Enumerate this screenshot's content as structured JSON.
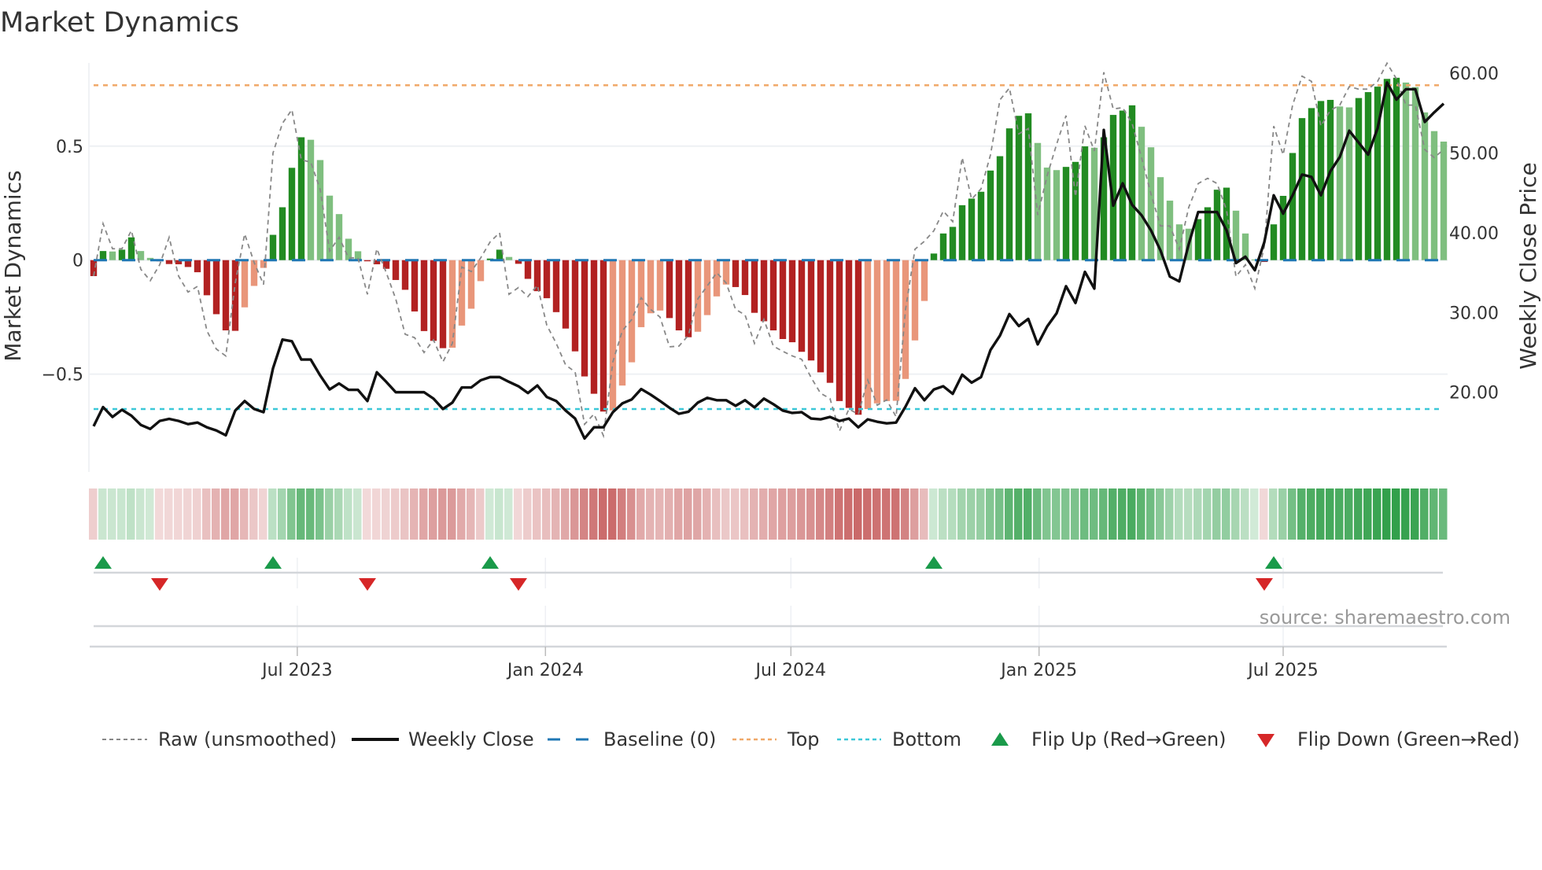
{
  "chart_data": {
    "type": "bar",
    "title": "Market Dynamics",
    "ylabel": "Market Dynamics",
    "ylabel_right": "Weekly Close Price",
    "start_date": "2023-01-31",
    "frequency": "weekly",
    "ylim": [
      -0.929,
      0.865
    ],
    "ylim_right": [
      10,
      61.3
    ],
    "yticks": [
      {
        "value": 0.5,
        "label": "0.5"
      },
      {
        "value": 0,
        "label": "0"
      },
      {
        "value": -0.5,
        "label": "−0.5"
      }
    ],
    "yticks_right": [
      {
        "value": 60,
        "label": "60.00"
      },
      {
        "value": 50,
        "label": "50.00"
      },
      {
        "value": 40,
        "label": "40.00"
      },
      {
        "value": 30,
        "label": "30.00"
      },
      {
        "value": 20,
        "label": "20.00"
      }
    ],
    "xticks": [
      {
        "date": "2023-07-01",
        "label": "Jul 2023"
      },
      {
        "date": "2024-01-01",
        "label": "Jan 2024"
      },
      {
        "date": "2024-07-01",
        "label": "Jul 2024"
      },
      {
        "date": "2025-01-01",
        "label": "Jan 2025"
      },
      {
        "date": "2025-07-01",
        "label": "Jul 2025"
      }
    ],
    "grid": true,
    "baseline": 0,
    "top_level": 0.767,
    "bottom_level": -0.653,
    "momentum": [
      -0.07,
      0.04,
      0.038,
      0.046,
      0.1,
      0.04,
      0.01,
      -0.005,
      -0.017,
      -0.018,
      -0.03,
      -0.053,
      -0.154,
      -0.237,
      -0.308,
      -0.31,
      -0.207,
      -0.113,
      -0.034,
      0.111,
      0.232,
      0.405,
      0.539,
      0.528,
      0.439,
      0.283,
      0.202,
      0.094,
      0.039,
      -0.005,
      -0.018,
      -0.038,
      -0.087,
      -0.13,
      -0.225,
      -0.311,
      -0.354,
      -0.386,
      -0.384,
      -0.287,
      -0.213,
      -0.092,
      0.007,
      0.046,
      0.014,
      -0.016,
      -0.082,
      -0.136,
      -0.167,
      -0.228,
      -0.3,
      -0.4,
      -0.51,
      -0.586,
      -0.664,
      -0.659,
      -0.55,
      -0.448,
      -0.294,
      -0.233,
      -0.221,
      -0.254,
      -0.308,
      -0.338,
      -0.314,
      -0.241,
      -0.159,
      -0.107,
      -0.118,
      -0.153,
      -0.231,
      -0.268,
      -0.308,
      -0.346,
      -0.36,
      -0.402,
      -0.44,
      -0.492,
      -0.538,
      -0.618,
      -0.648,
      -0.678,
      -0.653,
      -0.628,
      -0.618,
      -0.617,
      -0.521,
      -0.352,
      -0.179,
      0.029,
      0.117,
      0.146,
      0.241,
      0.27,
      0.3,
      0.393,
      0.456,
      0.578,
      0.633,
      0.644,
      0.514,
      0.406,
      0.395,
      0.409,
      0.431,
      0.499,
      0.493,
      0.539,
      0.637,
      0.656,
      0.679,
      0.585,
      0.495,
      0.364,
      0.261,
      0.157,
      0.138,
      0.18,
      0.232,
      0.309,
      0.318,
      0.217,
      0.117,
      0.003,
      -0.008,
      0.157,
      0.282,
      0.47,
      0.623,
      0.667,
      0.698,
      0.703,
      0.674,
      0.67,
      0.711,
      0.737,
      0.761,
      0.795,
      0.8,
      0.779,
      0.759,
      0.648,
      0.566,
      0.52
    ],
    "raw": [
      -0.07,
      0.16,
      0.05,
      0.05,
      0.13,
      -0.04,
      -0.09,
      -0.02,
      0.1,
      -0.07,
      -0.14,
      -0.115,
      -0.31,
      -0.39,
      -0.42,
      -0.1,
      0.115,
      -0.01,
      -0.107,
      0.47,
      0.6,
      0.66,
      0.44,
      0.43,
      0.31,
      0.04,
      0.1,
      0.01,
      0.01,
      -0.15,
      0.05,
      -0.055,
      -0.17,
      -0.325,
      -0.34,
      -0.405,
      -0.35,
      -0.446,
      -0.365,
      -0.03,
      -0.05,
      0.01,
      0.08,
      0.12,
      -0.15,
      -0.12,
      -0.16,
      -0.11,
      -0.285,
      -0.365,
      -0.46,
      -0.49,
      -0.72,
      -0.675,
      -0.77,
      -0.446,
      -0.31,
      -0.26,
      -0.165,
      -0.216,
      -0.25,
      -0.38,
      -0.377,
      -0.33,
      -0.17,
      -0.113,
      -0.055,
      -0.1,
      -0.216,
      -0.24,
      -0.365,
      -0.26,
      -0.377,
      -0.4,
      -0.42,
      -0.435,
      -0.515,
      -0.584,
      -0.607,
      -0.75,
      -0.653,
      -0.676,
      -0.526,
      -0.636,
      -0.613,
      -0.687,
      -0.216,
      0.048,
      0.083,
      0.129,
      0.215,
      0.169,
      0.45,
      0.267,
      0.313,
      0.462,
      0.703,
      0.755,
      0.554,
      0.577,
      0.198,
      0.37,
      0.508,
      0.634,
      0.278,
      0.589,
      0.479,
      0.824,
      0.663,
      0.669,
      0.6,
      0.45,
      0.29,
      0.15,
      0.15,
      0.048,
      0.232,
      0.336,
      0.359,
      0.336,
      0.22,
      -0.072,
      -0.02,
      -0.124,
      0.06,
      0.588,
      0.462,
      0.68,
      0.807,
      0.784,
      0.588,
      0.657,
      0.68,
      0.761,
      0.75,
      0.75,
      0.784,
      0.864,
      0.795,
      0.68,
      0.68,
      0.485,
      0.45,
      0.485
    ],
    "close": [
      15.74,
      18.14,
      16.9,
      17.8,
      17.06,
      15.9,
      15.4,
      16.4,
      16.66,
      16.4,
      16.0,
      16.2,
      15.6,
      15.2,
      14.6,
      17.7,
      18.9,
      17.9,
      17.5,
      23.0,
      26.6,
      26.4,
      24.1,
      24.1,
      22.1,
      20.35,
      21.1,
      20.3,
      20.3,
      18.9,
      22.5,
      21.3,
      20.0,
      20.0,
      20.0,
      20.0,
      19.2,
      17.9,
      18.7,
      20.6,
      20.6,
      21.5,
      21.9,
      21.9,
      21.3,
      20.75,
      19.9,
      20.85,
      19.4,
      18.9,
      17.7,
      16.7,
      14.2,
      15.6,
      15.6,
      17.5,
      18.6,
      19.1,
      20.4,
      19.7,
      18.9,
      18.05,
      17.3,
      17.55,
      18.7,
      19.3,
      19.0,
      19.0,
      18.3,
      19.0,
      18.1,
      19.2,
      18.5,
      17.7,
      17.4,
      17.5,
      16.7,
      16.6,
      16.9,
      16.4,
      16.7,
      15.6,
      16.6,
      16.3,
      16.1,
      16.2,
      18.2,
      20.5,
      19.0,
      20.35,
      20.75,
      19.8,
      22.2,
      21.2,
      21.9,
      25.3,
      27.1,
      29.8,
      28.3,
      29.2,
      26.0,
      28.25,
      29.9,
      33.3,
      31.2,
      35.1,
      33.0,
      52.9,
      43.4,
      46.2,
      43.5,
      42.2,
      40.3,
      37.8,
      34.5,
      33.9,
      38.6,
      42.6,
      42.6,
      42.6,
      40.3,
      36.2,
      37.0,
      35.3,
      38.8,
      44.7,
      42.4,
      44.7,
      47.3,
      47.0,
      44.7,
      47.7,
      49.5,
      52.8,
      51.3,
      49.8,
      53.1,
      58.85,
      56.7,
      58.0,
      58.0,
      53.9,
      55.1,
      56.2
    ],
    "flip_up_weeks": [
      1,
      19,
      42,
      89,
      125
    ],
    "flip_down_weeks": [
      7,
      29,
      45,
      124
    ],
    "legend": {
      "placement": "bottom",
      "entries": [
        "Raw (unsmoothed)",
        "Weekly Close",
        "Baseline (0)",
        "Top",
        "Bottom",
        "Flip Up (Red→Green)",
        "Flip Down (Green→Red)"
      ]
    },
    "source": "source: sharemaestro.com"
  },
  "colors": {
    "green_strong": "#228b22",
    "green_weak": "#7fbf7f",
    "red_strong": "#b22222",
    "red_weak": "#e9967a",
    "baseline": "#1f77b4",
    "top": "#f0a868",
    "bottom": "#3cc8d8",
    "raw": "#888888",
    "close": "#111111",
    "flip_up": "#1a9a4a",
    "flip_down": "#d62728"
  }
}
